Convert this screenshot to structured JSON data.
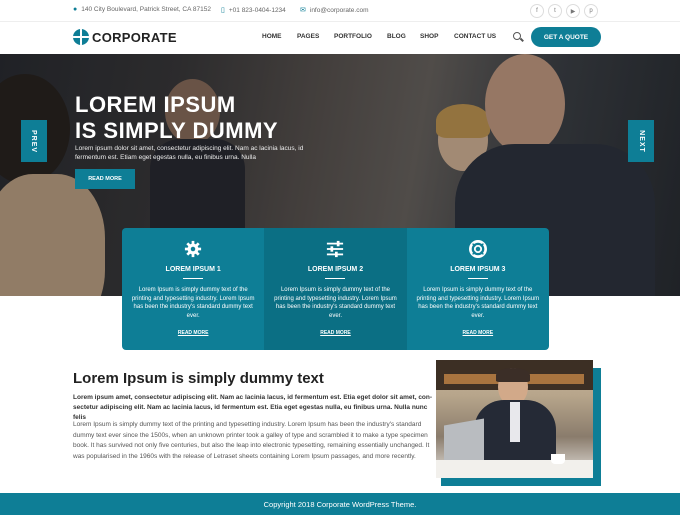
{
  "topbar": {
    "address": "140 City Boulevard, Patrick Street, CA 87152",
    "phone": "+01 823-0404-1234",
    "email": "info@corporate.com",
    "social": [
      "f",
      "t",
      "▶",
      "p"
    ]
  },
  "header": {
    "logo": "CORPORATE",
    "nav": [
      "HOME",
      "PAGES",
      "PORTFOLIO",
      "BLOG",
      "SHOP",
      "CONTACT US"
    ],
    "cta": "GET A QUOTE"
  },
  "hero": {
    "title_line1": "LOREM IPSUM",
    "title_line2": "IS SIMPLY DUMMY",
    "subtitle": "Lorem ipsum dolor sit amet, consectetur adipiscing elit. Nam ac lacinia lacus, id fermentum est. Etiam eget egestas nulla, eu finibus urna. Nulla",
    "button": "READ MORE",
    "prev": "PREV",
    "next": "NEXT"
  },
  "features": [
    {
      "title": "LOREM IPSUM 1",
      "text": "Lorem Ipsum is simply dummy text of the printing and typesetting industry. Lorem Ipsum has been the industry's standard dummy text ever.",
      "more": "READ MORE",
      "icon": "gear-icon"
    },
    {
      "title": "LOREM IPSUM 2",
      "text": "Lorem Ipsum is simply dummy text of the printing and typesetting industry. Lorem Ipsum has been the industry's standard dummy text ever.",
      "more": "READ MORE",
      "icon": "sliders-icon"
    },
    {
      "title": "LOREM IPSUM 3",
      "text": "Lorem Ipsum is simply dummy text of the printing and typesetting industry. Lorem Ipsum has been the industry's standard dummy text ever.",
      "more": "READ MORE",
      "icon": "lifebuoy-icon"
    }
  ],
  "about": {
    "title": "Lorem Ipsum is simply dummy text",
    "bold": "Lorem ipsum amet, consectetur adipiscing elit. Nam ac lacinia lacus, id fermentum est. Etia eget dolor sit amet, con-sectetur adipiscing elit. Nam ac lacinia lacus, id fermentum est. Etia eget egestas nulla, eu finibus urna. Nulla nunc felis",
    "text": "Lorem Ipsum is simply dummy text of the printing and typesetting industry. Lorem Ipsum has been the industry's standard dummy text ever since the 1500s, when an unknown printer took a galley of type and scrambled it to make a type specimen book. It has survived not only five centuries, but also the leap into electronic typesetting, remaining essentially unchanged. It was popularised in the 1960s with the release of Letraset sheets containing Lorem Ipsum passages, and more recently."
  },
  "footer": {
    "text": "Copyright 2018 Corporate WordPress Theme."
  },
  "colors": {
    "accent": "#0e7e96",
    "accent_dark": "#0b6f84"
  }
}
